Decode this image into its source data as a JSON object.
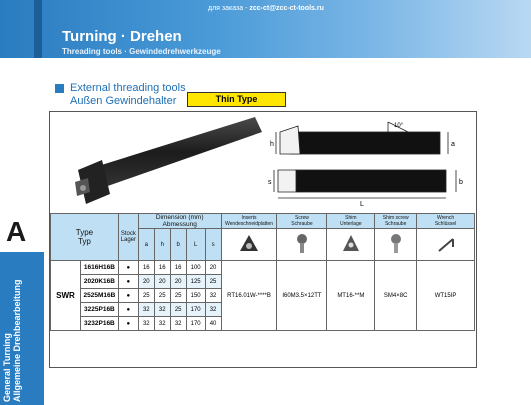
{
  "header": {
    "email_label": "для заказа -",
    "email": "zcc-ct@zcc-ct-tools.ru",
    "title": "Turning · Drehen",
    "subtitle": "Threading tools · Gewindedrehwerkzeuge"
  },
  "sidebar": {
    "letter": "A",
    "line1": "General Turning",
    "line2": "Allgemeine Drehbearbeitung"
  },
  "section": {
    "title_en": "External threading tools",
    "title_de": "Außen Gewindehalter",
    "badge": "Thin Type"
  },
  "image": {
    "photo_label": "R",
    "dims": {
      "h": "h",
      "s": "s",
      "a": "a",
      "b": "b",
      "L": "L",
      "angle": "10°"
    }
  },
  "table": {
    "col_type": "Type",
    "col_type_de": "Typ",
    "col_stock": "Stock",
    "col_stock_de": "Lager",
    "col_dims": "Dimension (mm)",
    "col_dims_de": "Abmessung",
    "dim_cols": [
      "a",
      "h",
      "b",
      "L",
      "s"
    ],
    "parts": [
      {
        "en": "Inserts",
        "de": "Wendeschneidplatten",
        "icon": "insert-icon"
      },
      {
        "en": "Screw",
        "de": "Schraube",
        "icon": "screw-icon"
      },
      {
        "en": "Shim",
        "de": "Unterlage",
        "icon": "shim-icon"
      },
      {
        "en": "Shim screw",
        "de": "Schraube",
        "icon": "shim-screw-icon"
      },
      {
        "en": "Wrench",
        "de": "Schlüssel",
        "icon": "wrench-icon"
      }
    ],
    "group": "SWR",
    "rows": [
      {
        "model": "1616H16B",
        "stock": "●",
        "a": "16",
        "h": "16",
        "b": "16",
        "L": "100",
        "s": "20"
      },
      {
        "model": "2020K16B",
        "stock": "●",
        "a": "20",
        "h": "20",
        "b": "20",
        "L": "125",
        "s": "25"
      },
      {
        "model": "2525M16B",
        "stock": "●",
        "a": "25",
        "h": "25",
        "b": "25",
        "L": "150",
        "s": "32"
      },
      {
        "model": "3225P16B",
        "stock": "●",
        "a": "32",
        "h": "32",
        "b": "25",
        "L": "170",
        "s": "32"
      },
      {
        "model": "3232P16B",
        "stock": "●",
        "a": "32",
        "h": "32",
        "b": "32",
        "L": "170",
        "s": "40"
      }
    ],
    "part_numbers": [
      "RT16.01W-****B",
      "I60M3.5×12TT",
      "MT16-**M",
      "SM4×8C",
      "WT15IP"
    ]
  }
}
